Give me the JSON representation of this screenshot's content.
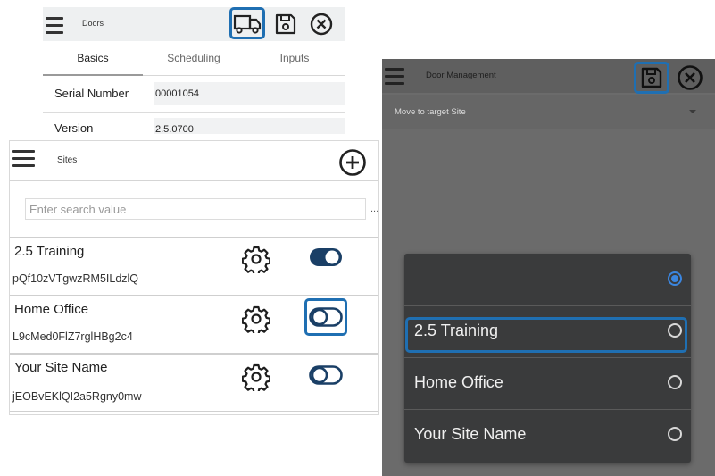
{
  "doors": {
    "title": "Doors",
    "tabs": [
      "Basics",
      "Scheduling",
      "Inputs"
    ],
    "rows": [
      {
        "label": "Serial Number",
        "value": "00001054"
      },
      {
        "label": "Version",
        "value": "2.5.0700"
      }
    ],
    "icons": [
      "menu-icon",
      "truck-icon",
      "save-icon",
      "close-icon"
    ]
  },
  "sites": {
    "title": "Sites",
    "search": {
      "placeholder": "Enter search value",
      "value": ""
    },
    "more": "...",
    "items": [
      {
        "name": "2.5 Training",
        "code": "pQf10zVTgwzRM5ILdzlQ",
        "enabled": true
      },
      {
        "name": "Home Office",
        "code": "L9cMed0FlZ7rglHBg2c4",
        "enabled": false
      },
      {
        "name": "Your Site Name",
        "code": "jEOBvEKlQI2a5Rgny0mw",
        "enabled": false
      }
    ]
  },
  "door_management": {
    "title": "Door Management",
    "select_placeholder": "Move to target Site",
    "options": [
      {
        "label": "",
        "selected": true
      },
      {
        "label": "2.5 Training",
        "selected": false
      },
      {
        "label": "Home Office",
        "selected": false
      },
      {
        "label": "Your Site Name",
        "selected": false
      }
    ]
  },
  "colors": {
    "highlight": "#1f6fb2",
    "toggle_on": "#1a3f66",
    "radio_on": "#3b86e0"
  }
}
